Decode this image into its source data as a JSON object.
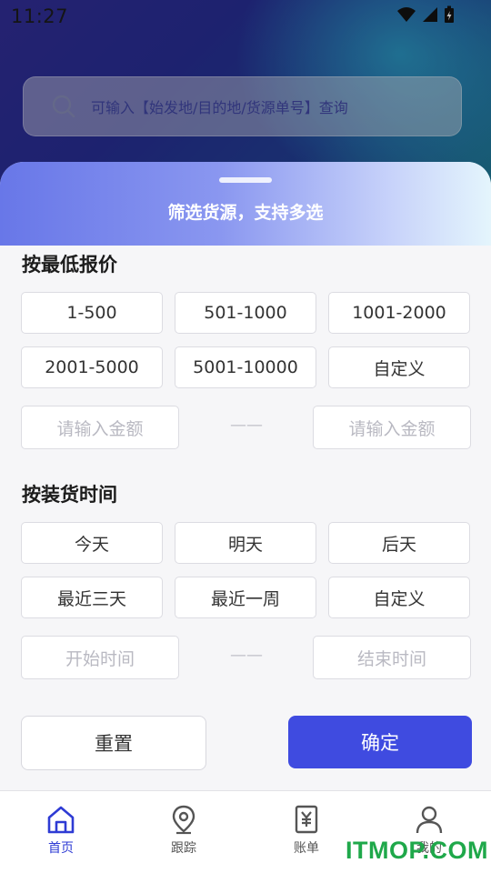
{
  "status_bar": {
    "time": "11:27"
  },
  "search": {
    "placeholder": "可输入【始发地/目的地/货源单号】查询"
  },
  "sheet": {
    "title": "筛选货源，支持多选",
    "price_section": {
      "title": "按最低报价",
      "options": [
        "1-500",
        "501-1000",
        "1001-2000",
        "2001-5000",
        "5001-10000",
        "自定义"
      ],
      "min_placeholder": "请输入金额",
      "separator": "——",
      "max_placeholder": "请输入金额"
    },
    "time_section": {
      "title": "按装货时间",
      "options": [
        "今天",
        "明天",
        "后天",
        "最近三天",
        "最近一周",
        "自定义"
      ],
      "start_placeholder": "开始时间",
      "separator": "——",
      "end_placeholder": "结束时间"
    },
    "reset_label": "重置",
    "confirm_label": "确定"
  },
  "bottom_nav": [
    {
      "label": "首页",
      "icon": "home-icon",
      "active": true
    },
    {
      "label": "跟踪",
      "icon": "location-pin-icon",
      "active": false
    },
    {
      "label": "账单",
      "icon": "bill-icon",
      "active": false
    },
    {
      "label": "我的",
      "icon": "user-icon",
      "active": false
    }
  ],
  "watermark": "ITMOP.COM",
  "colors": {
    "primary": "#3f4be0",
    "nav_active": "#2e3bd4"
  }
}
